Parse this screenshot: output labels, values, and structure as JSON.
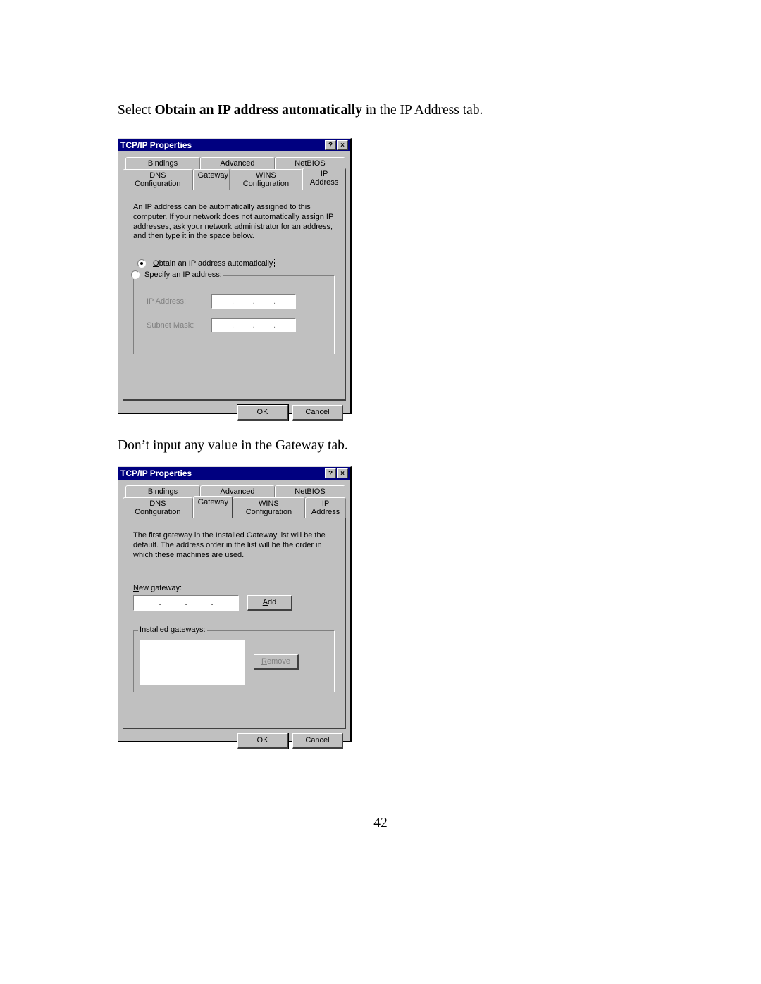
{
  "page_number": "42",
  "instruction1": {
    "prefix": "Select ",
    "bold": "Obtain an IP address automatically",
    "suffix": " in the IP Address tab."
  },
  "instruction2": "Don’t input any value in the Gateway tab.",
  "dialog_title": "TCP/IP Properties",
  "titlebar": {
    "help": "?",
    "close": "×"
  },
  "tabs": {
    "bindings": "Bindings",
    "advanced": "Advanced",
    "netbios": "NetBIOS",
    "dns": "DNS Configuration",
    "gateway": "Gateway",
    "wins": "WINS Configuration",
    "ip": "IP Address"
  },
  "ip_tab": {
    "description": "An IP address can be automatically assigned to this computer. If your network does not automatically assign IP addresses, ask your network administrator for an address, and then type it in the space below.",
    "radio_obtain": {
      "u": "O",
      "rest": "btain an IP address automatically"
    },
    "radio_specify": {
      "u": "S",
      "rest": "pecify an IP address:"
    },
    "ip_address_label": "IP Address:",
    "subnet_mask_label": "Subnet Mask:"
  },
  "gateway_tab": {
    "description": "The first gateway in the Installed Gateway list will be the default. The address order in the list will be the order in which these machines are used.",
    "new_gateway": {
      "u": "N",
      "rest": "ew gateway:"
    },
    "installed_gateways": {
      "u": "I",
      "rest": "nstalled gateways:"
    },
    "add_btn": {
      "u": "A",
      "rest": "dd"
    },
    "remove_btn": {
      "u": "R",
      "rest": "emove"
    }
  },
  "buttons": {
    "ok": "OK",
    "cancel": "Cancel"
  }
}
